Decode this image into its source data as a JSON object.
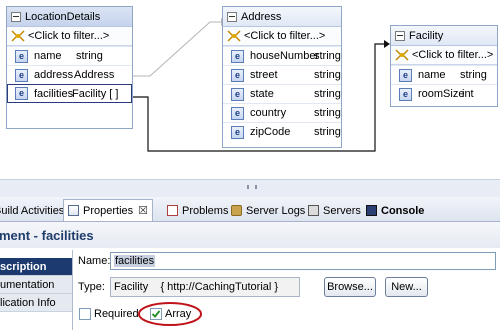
{
  "diagram": {
    "location_details": {
      "title": "LocationDetails",
      "filter": "<Click to filter...>",
      "fields": [
        {
          "name": "name",
          "type": "string"
        },
        {
          "name": "address",
          "type": "Address"
        },
        {
          "name": "facilities",
          "type": "Facility [ ]"
        }
      ]
    },
    "address": {
      "title": "Address",
      "filter": "<Click to filter...>",
      "fields": [
        {
          "name": "houseNumber",
          "type": "string"
        },
        {
          "name": "street",
          "type": "string"
        },
        {
          "name": "state",
          "type": "string"
        },
        {
          "name": "country",
          "type": "string"
        },
        {
          "name": "zipCode",
          "type": "string"
        }
      ]
    },
    "facility": {
      "title": "Facility",
      "filter": "<Click to filter...>",
      "fields": [
        {
          "name": "name",
          "type": "string"
        },
        {
          "name": "roomSize",
          "type": "int"
        }
      ]
    },
    "element_icon_letter": "e"
  },
  "tabs": [
    {
      "label": "Build Activities"
    },
    {
      "label": "Properties"
    },
    {
      "label": "Problems"
    },
    {
      "label": "Server Logs"
    },
    {
      "label": "Servers"
    },
    {
      "label": "Console"
    }
  ],
  "properties": {
    "header": "ment - facilities",
    "side_items": [
      "scription",
      "umentation",
      "lication Info"
    ],
    "name_label": "Name:",
    "name_value": "facilities",
    "type_label": "Type:",
    "type_value": "Facility    { http://CachingTutorial }",
    "browse_label": "Browse...",
    "new_label": "New...",
    "required_label": "Required",
    "array_label": "Array",
    "required_checked": false,
    "array_checked": true,
    "highlight_color": "#c0121a"
  }
}
